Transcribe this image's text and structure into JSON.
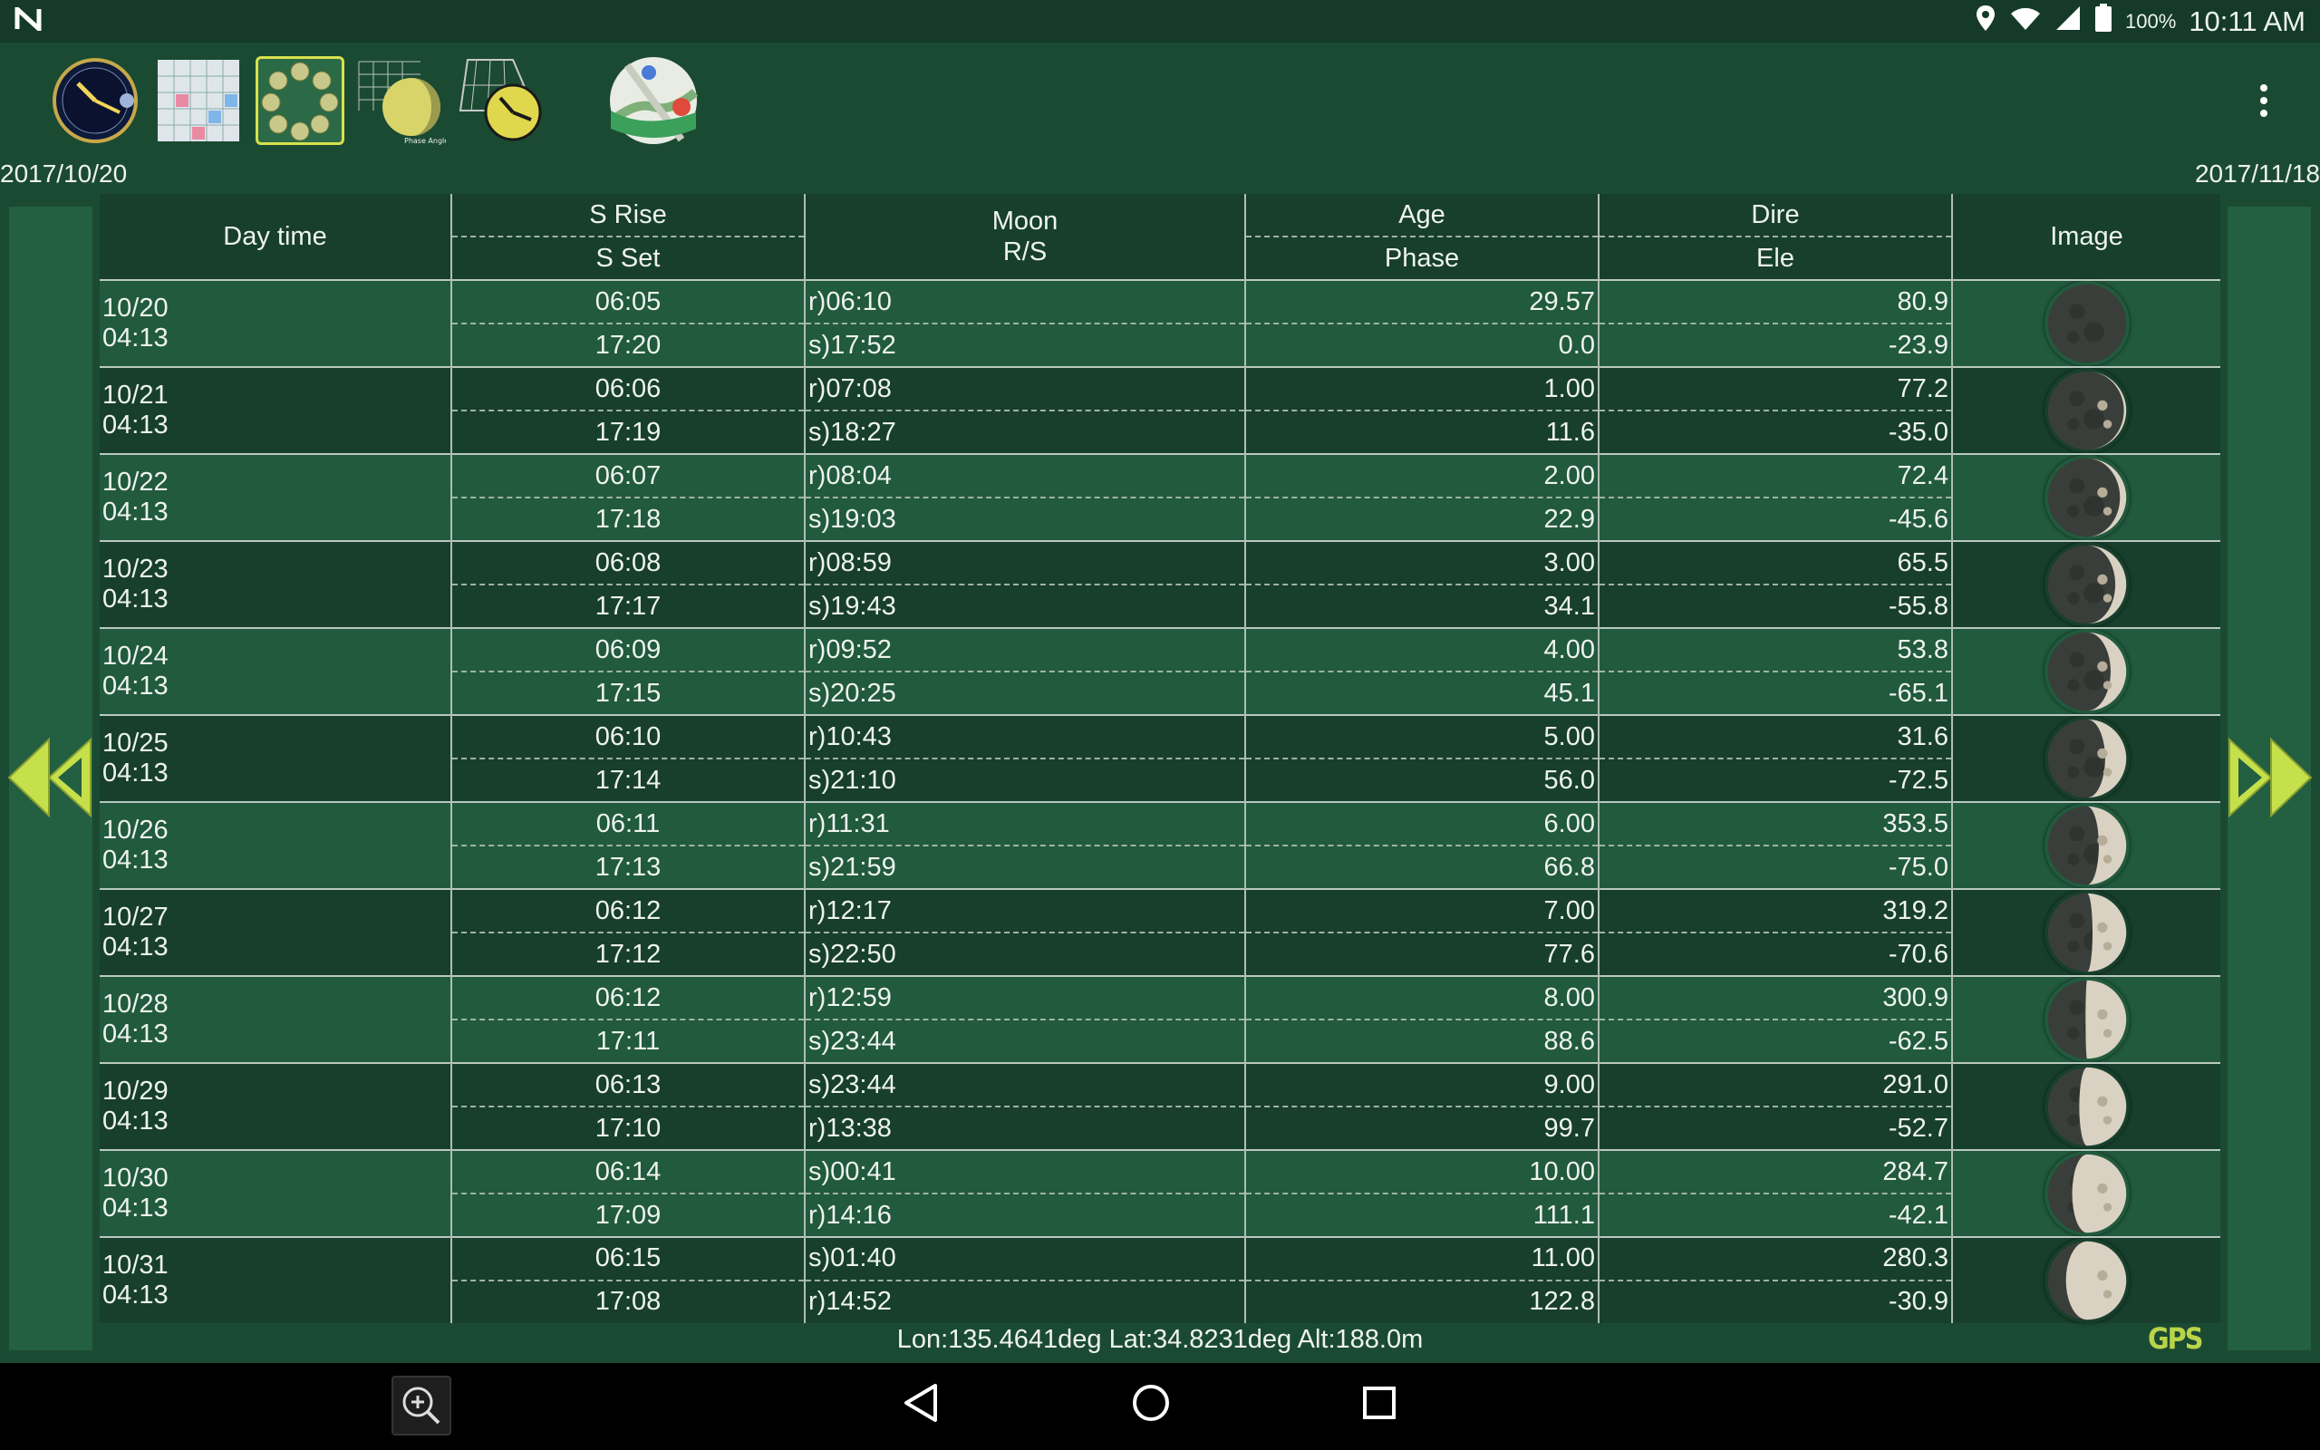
{
  "status": {
    "time": "10:11 AM",
    "battery": "100%"
  },
  "header": {
    "date_start": "2017/10/20",
    "date_end": "2017/11/18",
    "tool_icons": [
      "clock-dial-icon",
      "calendar-grid-icon",
      "moon-phase-grid-icon",
      "phase-angle-grid-icon",
      "sun-path-clock-icon",
      "map-icon"
    ],
    "tool_icon_caption": "Phase Angle"
  },
  "table": {
    "headers": {
      "day_time": "Day time",
      "s_rise": "S Rise",
      "s_set": "S Set",
      "moon": "Moon",
      "moon_rs": "R/S",
      "age": "Age",
      "phase": "Phase",
      "dire": "Dire",
      "ele": "Ele",
      "image": "Image"
    },
    "rows": [
      {
        "date": "10/20",
        "time": "04:13",
        "s_rise": "06:05",
        "s_set": "17:20",
        "moon1": "r)06:10",
        "moon2": "s)17:52",
        "age": "29.57",
        "phase": "0.0",
        "dire": "80.9",
        "ele": "-23.9",
        "illum": 0.0
      },
      {
        "date": "10/21",
        "time": "04:13",
        "s_rise": "06:06",
        "s_set": "17:19",
        "moon1": "r)07:08",
        "moon2": "s)18:27",
        "age": "1.00",
        "phase": "11.6",
        "dire": "77.2",
        "ele": "-35.0",
        "illum": 0.03
      },
      {
        "date": "10/22",
        "time": "04:13",
        "s_rise": "06:07",
        "s_set": "17:18",
        "moon1": "r)08:04",
        "moon2": "s)19:03",
        "age": "2.00",
        "phase": "22.9",
        "dire": "72.4",
        "ele": "-45.6",
        "illum": 0.08
      },
      {
        "date": "10/23",
        "time": "04:13",
        "s_rise": "06:08",
        "s_set": "17:17",
        "moon1": "r)08:59",
        "moon2": "s)19:43",
        "age": "3.00",
        "phase": "34.1",
        "dire": "65.5",
        "ele": "-55.8",
        "illum": 0.14
      },
      {
        "date": "10/24",
        "time": "04:13",
        "s_rise": "06:09",
        "s_set": "17:15",
        "moon1": "r)09:52",
        "moon2": "s)20:25",
        "age": "4.00",
        "phase": "45.1",
        "dire": "53.8",
        "ele": "-65.1",
        "illum": 0.2
      },
      {
        "date": "10/25",
        "time": "04:13",
        "s_rise": "06:10",
        "s_set": "17:14",
        "moon1": "r)10:43",
        "moon2": "s)21:10",
        "age": "5.00",
        "phase": "56.0",
        "dire": "31.6",
        "ele": "-72.5",
        "illum": 0.27
      },
      {
        "date": "10/26",
        "time": "04:13",
        "s_rise": "06:11",
        "s_set": "17:13",
        "moon1": "r)11:31",
        "moon2": "s)21:59",
        "age": "6.00",
        "phase": "66.8",
        "dire": "353.5",
        "ele": "-75.0",
        "illum": 0.35
      },
      {
        "date": "10/27",
        "time": "04:13",
        "s_rise": "06:12",
        "s_set": "17:12",
        "moon1": "r)12:17",
        "moon2": "s)22:50",
        "age": "7.00",
        "phase": "77.6",
        "dire": "319.2",
        "ele": "-70.6",
        "illum": 0.43
      },
      {
        "date": "10/28",
        "time": "04:13",
        "s_rise": "06:12",
        "s_set": "17:11",
        "moon1": "r)12:59",
        "moon2": "s)23:44",
        "age": "8.00",
        "phase": "88.6",
        "dire": "300.9",
        "ele": "-62.5",
        "illum": 0.52
      },
      {
        "date": "10/29",
        "time": "04:13",
        "s_rise": "06:13",
        "s_set": "17:10",
        "moon1": "s)23:44",
        "moon2": "r)13:38",
        "age": "9.00",
        "phase": "99.7",
        "dire": "291.0",
        "ele": "-52.7",
        "illum": 0.6
      },
      {
        "date": "10/30",
        "time": "04:13",
        "s_rise": "06:14",
        "s_set": "17:09",
        "moon1": "s)00:41",
        "moon2": "r)14:16",
        "age": "10.00",
        "phase": "111.1",
        "dire": "284.7",
        "ele": "-42.1",
        "illum": 0.69
      },
      {
        "date": "10/31",
        "time": "04:13",
        "s_rise": "06:15",
        "s_set": "17:08",
        "moon1": "s)01:40",
        "moon2": "r)14:52",
        "age": "11.00",
        "phase": "122.8",
        "dire": "280.3",
        "ele": "-30.9",
        "illum": 0.77
      }
    ]
  },
  "footer": {
    "location": "Lon:135.4641deg Lat:34.8231deg Alt:188.0m",
    "gps_label": "GPS"
  },
  "colors": {
    "background": "#1b4a33",
    "row_band_a": "#215a3d",
    "row_band_b": "#173f2c",
    "arrow": "#c6e04c"
  }
}
